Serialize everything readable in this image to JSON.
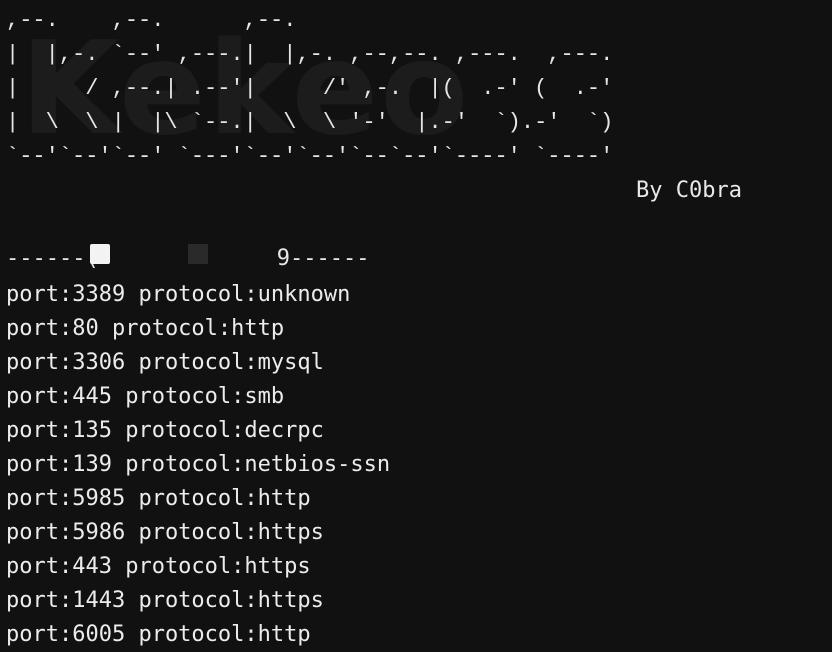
{
  "banner": {
    "logo_text": "Kekeo",
    "ascii_lines": [
      ",--.    ,--.      ,--.",
      "|  |,-. `--' ,---.|  |,-. ,--,--. ,---.  ,---.",
      "|     / ,--.| .--'|     /' ,-.  |(  .-' (  .-'",
      "|  \\  \\ |  |\\ `--.|  \\  \\ '-'  |.-'  `).-'  `)",
      "`--'`--'`--' `---'`--'`--'`--`--'`----' `----'"
    ],
    "byline": "By C0bra"
  },
  "separator": {
    "left": "------(",
    "right": "9------"
  },
  "results": [
    "port:3389 protocol:unknown",
    "port:80 protocol:http",
    "port:3306 protocol:mysql",
    "port:445 protocol:smb",
    "port:135 protocol:decrpc",
    "port:139 protocol:netbios-ssn",
    "port:5985 protocol:http",
    "port:5986 protocol:https",
    "port:443 protocol:https",
    "port:1443 protocol:https",
    "port:6005 protocol:http"
  ]
}
